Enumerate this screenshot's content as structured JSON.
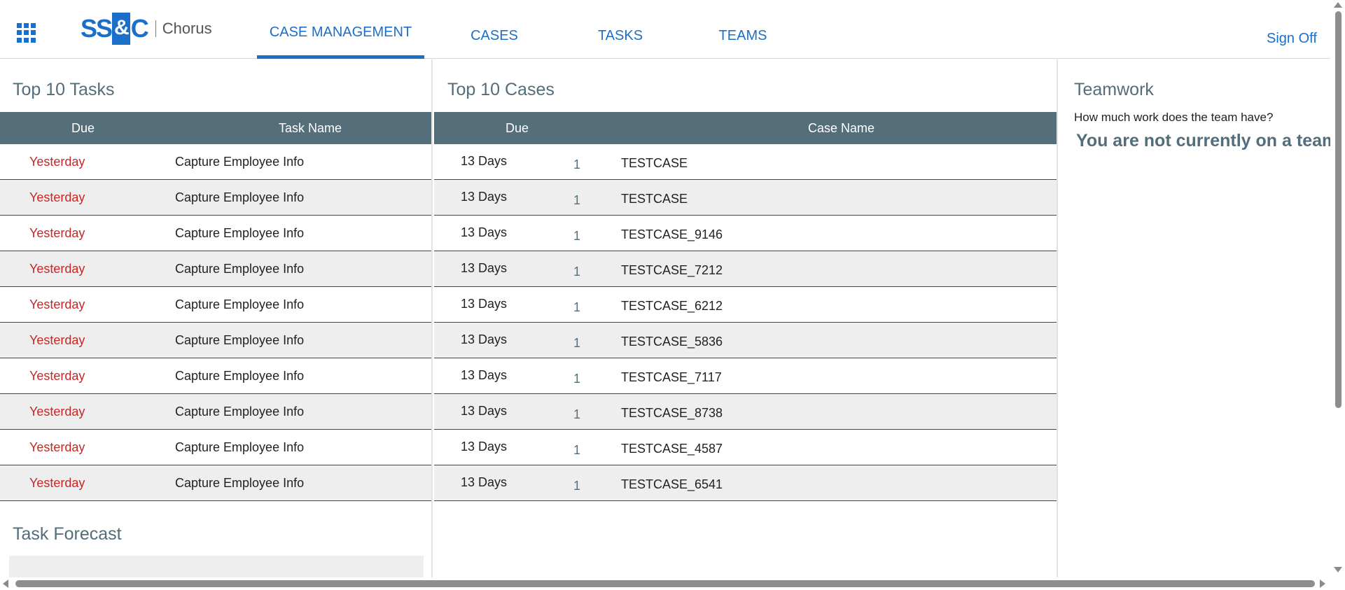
{
  "header": {
    "logo_left": "SS",
    "logo_amp": "&",
    "logo_right": "C",
    "product": "Chorus",
    "tabs": [
      {
        "label": "CASE MANAGEMENT",
        "active": true
      },
      {
        "label": "CASES",
        "active": false
      },
      {
        "label": "TASKS",
        "active": false
      },
      {
        "label": "TEAMS",
        "active": false
      }
    ],
    "sign_off": "Sign Off",
    "apps_icon": "grid-apps-icon",
    "accent_color": "#1c6fc9"
  },
  "tasks_panel": {
    "title": "Top 10 Tasks",
    "columns": {
      "due": "Due",
      "name": "Task Name"
    },
    "rows": [
      {
        "due": "Yesterday",
        "name": "Capture Employee Info"
      },
      {
        "due": "Yesterday",
        "name": "Capture Employee Info"
      },
      {
        "due": "Yesterday",
        "name": "Capture Employee Info"
      },
      {
        "due": "Yesterday",
        "name": "Capture Employee Info"
      },
      {
        "due": "Yesterday",
        "name": "Capture Employee Info"
      },
      {
        "due": "Yesterday",
        "name": "Capture Employee Info"
      },
      {
        "due": "Yesterday",
        "name": "Capture Employee Info"
      },
      {
        "due": "Yesterday",
        "name": "Capture Employee Info"
      },
      {
        "due": "Yesterday",
        "name": "Capture Employee Info"
      },
      {
        "due": "Yesterday",
        "name": "Capture Employee Info"
      }
    ],
    "overdue_color": "#c62828",
    "forecast_title": "Task Forecast"
  },
  "cases_panel": {
    "title": "Top 10 Cases",
    "columns": {
      "due": "Due",
      "name": "Case Name"
    },
    "rows": [
      {
        "due": "13 Days",
        "count": "1",
        "name": "TESTCASE"
      },
      {
        "due": "13 Days",
        "count": "1",
        "name": "TESTCASE"
      },
      {
        "due": "13 Days",
        "count": "1",
        "name": "TESTCASE_9146"
      },
      {
        "due": "13 Days",
        "count": "1",
        "name": "TESTCASE_7212"
      },
      {
        "due": "13 Days",
        "count": "1",
        "name": "TESTCASE_6212"
      },
      {
        "due": "13 Days",
        "count": "1",
        "name": "TESTCASE_5836"
      },
      {
        "due": "13 Days",
        "count": "1",
        "name": "TESTCASE_7117"
      },
      {
        "due": "13 Days",
        "count": "1",
        "name": "TESTCASE_8738"
      },
      {
        "due": "13 Days",
        "count": "1",
        "name": "TESTCASE_4587"
      },
      {
        "due": "13 Days",
        "count": "1",
        "name": "TESTCASE_6541"
      }
    ]
  },
  "teamwork_panel": {
    "title": "Teamwork",
    "question": "How much work does the team have?",
    "message": "You are not currently on a team."
  }
}
